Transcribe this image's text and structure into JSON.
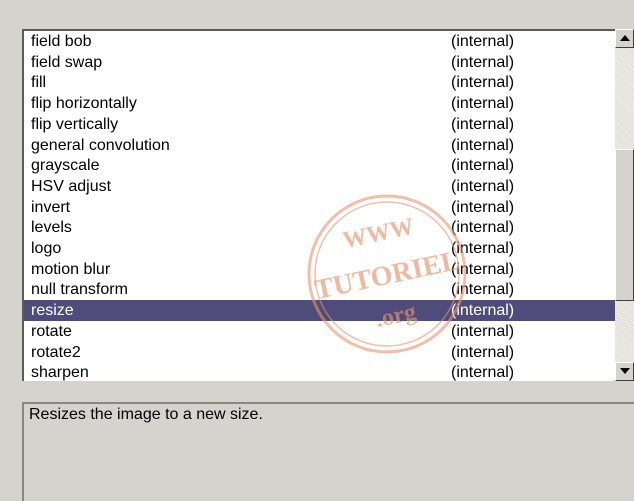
{
  "filters": [
    {
      "name": "field bob",
      "type": "(internal)"
    },
    {
      "name": "field swap",
      "type": "(internal)"
    },
    {
      "name": "fill",
      "type": "(internal)"
    },
    {
      "name": "flip horizontally",
      "type": "(internal)"
    },
    {
      "name": "flip vertically",
      "type": "(internal)"
    },
    {
      "name": "general convolution",
      "type": "(internal)"
    },
    {
      "name": "grayscale",
      "type": "(internal)"
    },
    {
      "name": "HSV adjust",
      "type": "(internal)"
    },
    {
      "name": "invert",
      "type": "(internal)"
    },
    {
      "name": "levels",
      "type": "(internal)"
    },
    {
      "name": "logo",
      "type": "(internal)"
    },
    {
      "name": "motion blur",
      "type": "(internal)"
    },
    {
      "name": "null transform",
      "type": "(internal)"
    },
    {
      "name": "resize",
      "type": "(internal)",
      "selected": true
    },
    {
      "name": "rotate",
      "type": "(internal)"
    },
    {
      "name": "rotate2",
      "type": "(internal)"
    },
    {
      "name": "sharpen",
      "type": "(internal)"
    }
  ],
  "description": "Resizes the image to a new size.",
  "watermark": {
    "line1": "WWW",
    "line2": "TUTORIEL",
    "line3": ".org"
  },
  "colors": {
    "selection": "#4f4b7b",
    "watermark": "#e8956e"
  },
  "icons": {
    "scroll_up": "arrow-up-icon",
    "scroll_down": "arrow-down-icon"
  }
}
